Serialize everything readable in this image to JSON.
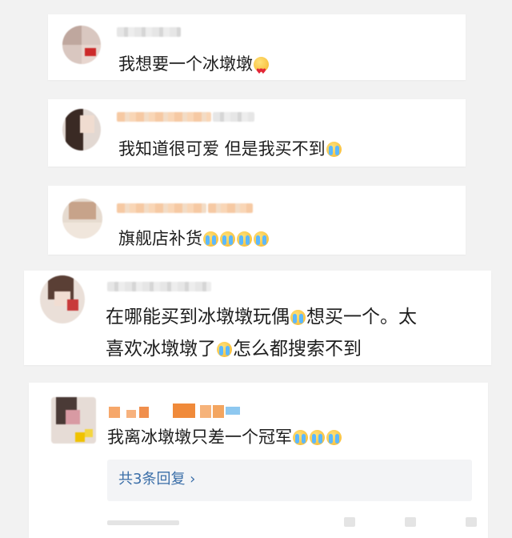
{
  "comments": [
    {
      "text": "我想要一个冰墩墩",
      "emoji": [
        "heart-eyes"
      ]
    },
    {
      "text": "我知道很可爱 但是我买不到",
      "emoji": [
        "crying"
      ]
    },
    {
      "text": "旗舰店补货",
      "emoji": [
        "crying",
        "crying",
        "crying",
        "crying"
      ]
    },
    {
      "line1": "在哪能买到冰墩墩玩偶",
      "line1_after": "想买一个。太",
      "line2": "喜欢冰墩墩了",
      "line2_after": "怎么都搜索不到",
      "emoji": [
        "crying",
        "crying"
      ]
    },
    {
      "text": "我离冰墩墩只差一个冠军",
      "emoji": [
        "crying",
        "crying",
        "crying"
      ],
      "reply_link": "共3条回复 ›"
    }
  ]
}
